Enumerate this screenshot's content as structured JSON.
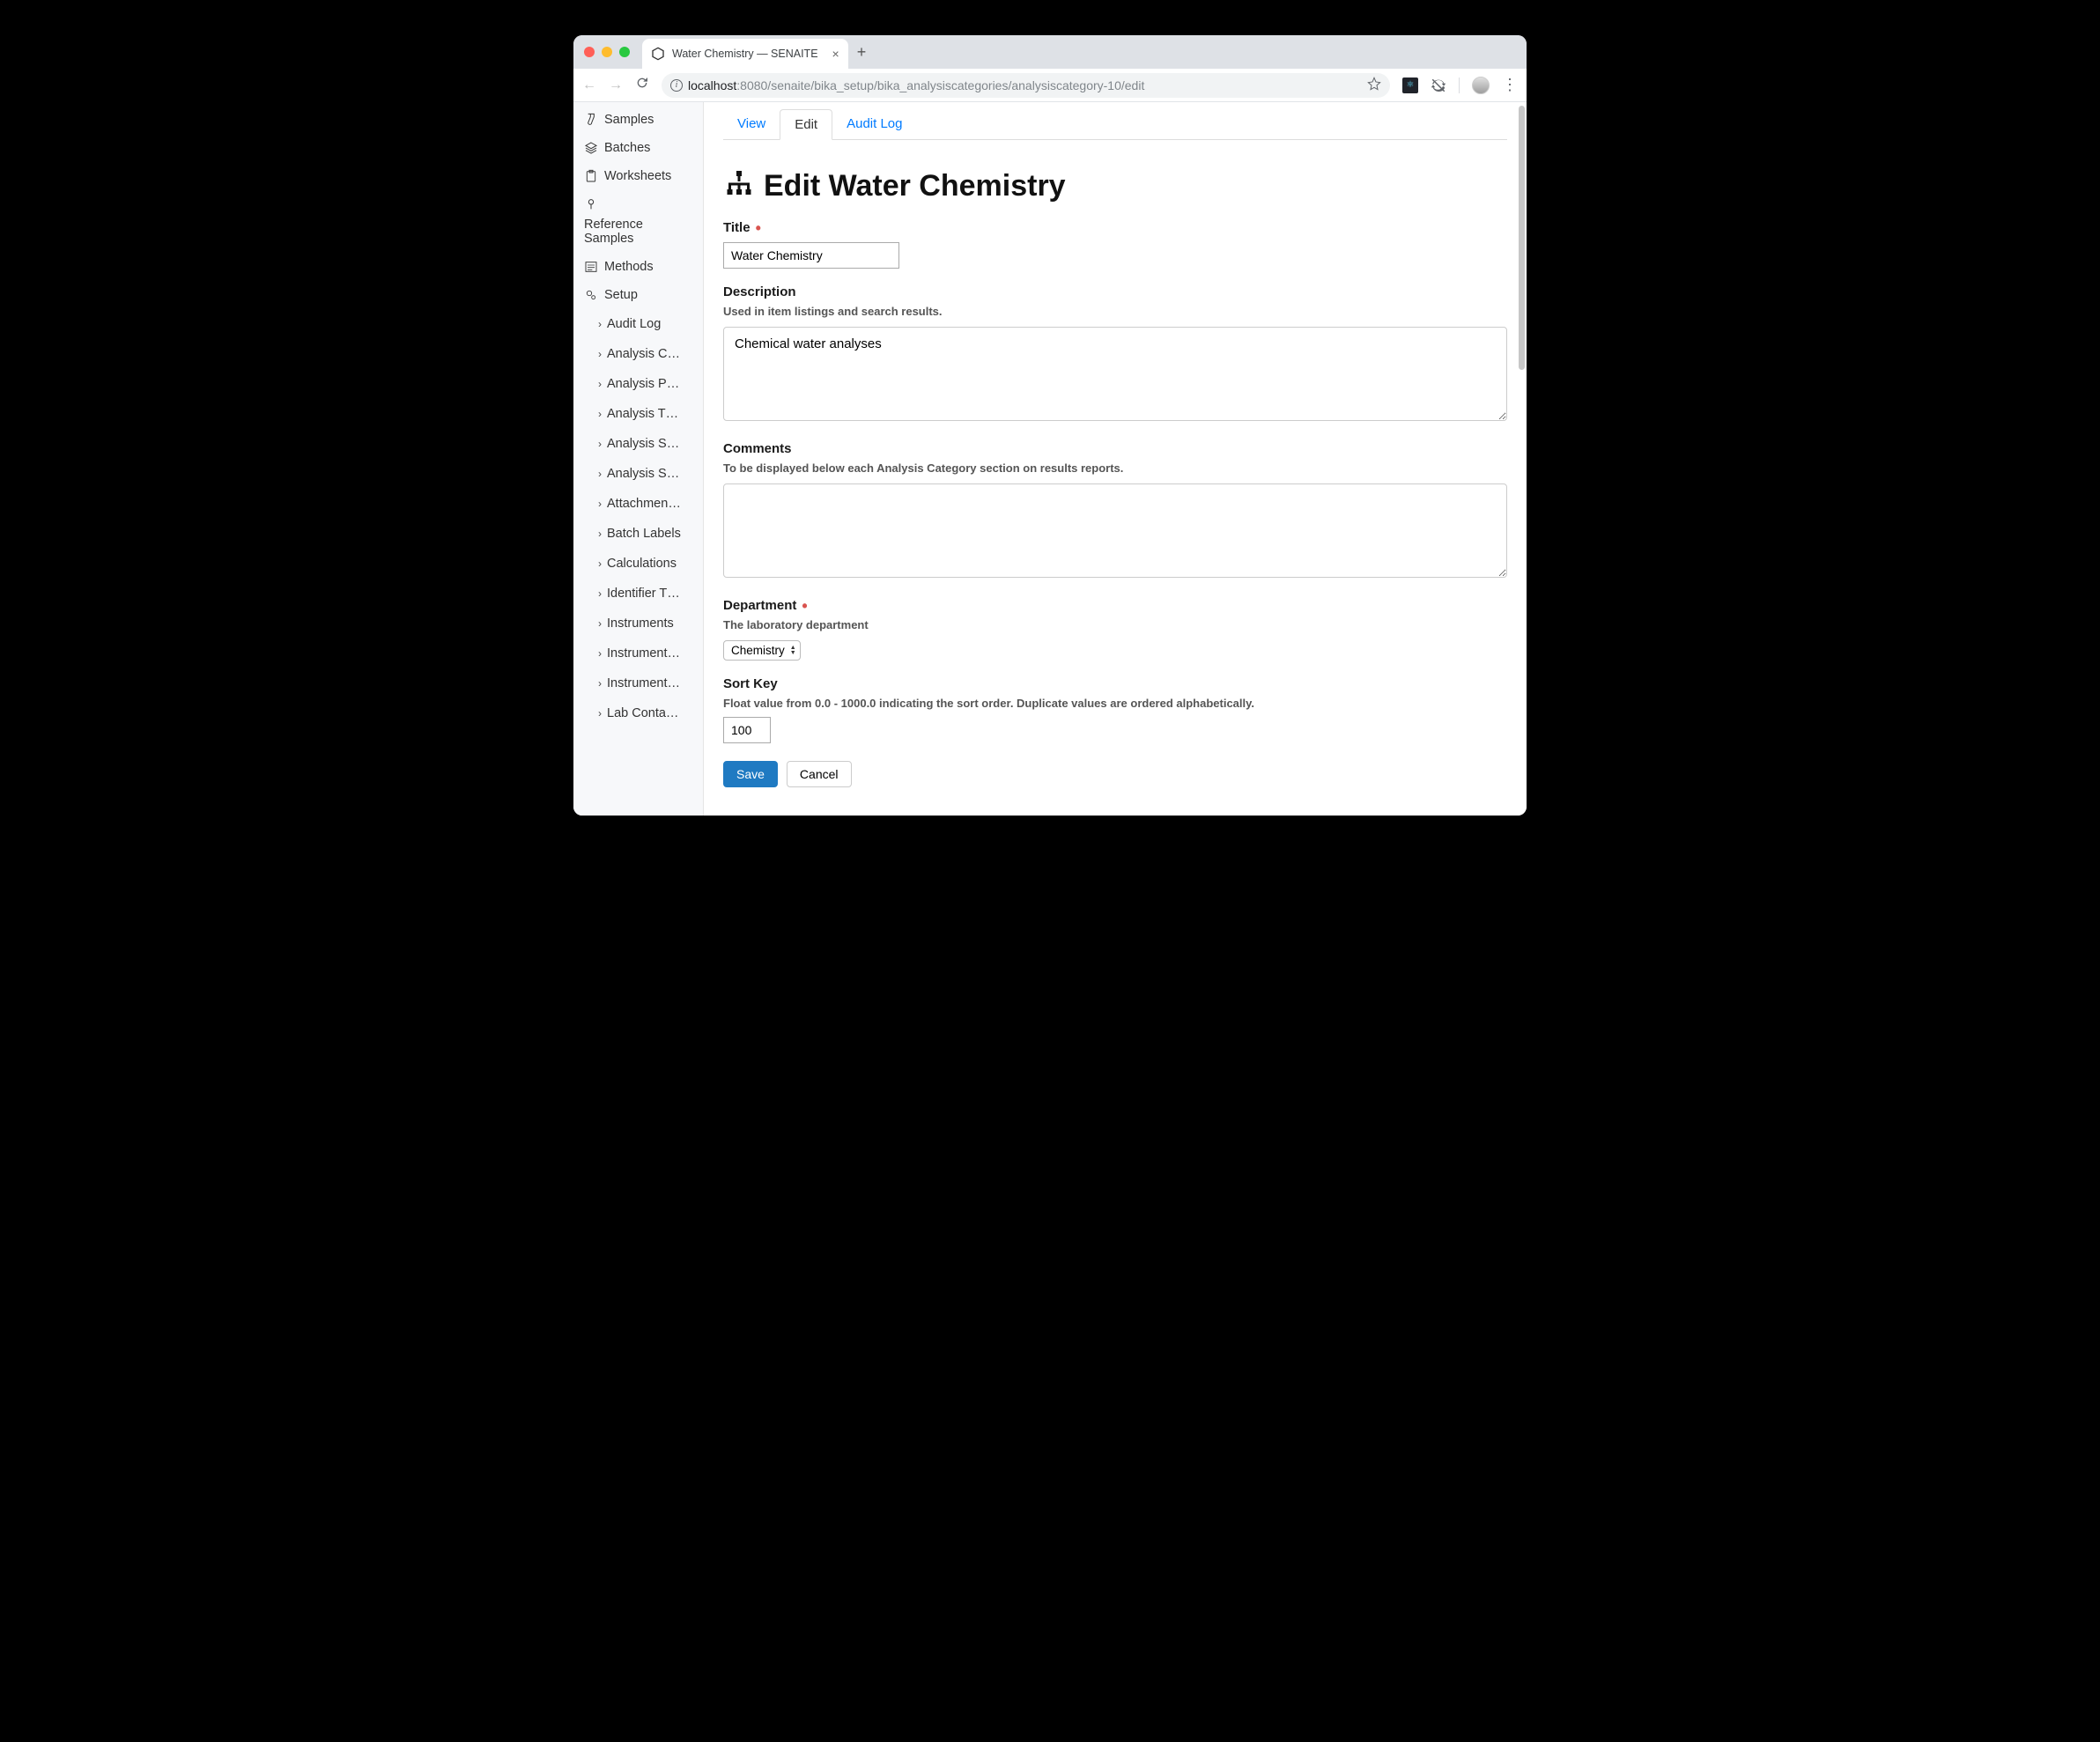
{
  "browser": {
    "tab_title": "Water Chemistry — SENAITE",
    "url_host": "localhost",
    "url_path": ":8080/senaite/bika_setup/bika_analysiscategories/analysiscategory-10/edit"
  },
  "sidebar": {
    "items": [
      {
        "icon": "samples",
        "label": "Samples"
      },
      {
        "icon": "batches",
        "label": "Batches"
      },
      {
        "icon": "worksheets",
        "label": "Worksheets"
      },
      {
        "icon": "reference",
        "label": "Reference Samples"
      },
      {
        "icon": "methods",
        "label": "Methods"
      },
      {
        "icon": "setup",
        "label": "Setup"
      }
    ],
    "setup_children": [
      "Audit Log",
      "Analysis C…",
      "Analysis P…",
      "Analysis T…",
      "Analysis S…",
      "Analysis S…",
      "Attachmen…",
      "Batch Labels",
      "Calculations",
      "Identifier T…",
      "Instruments",
      "Instrument…",
      "Instrument…",
      "Lab Conta…"
    ]
  },
  "tabs": {
    "view": "View",
    "edit": "Edit",
    "audit_log": "Audit Log"
  },
  "page": {
    "heading": "Edit Water Chemistry"
  },
  "form": {
    "title": {
      "label": "Title",
      "value": "Water Chemistry",
      "required": true
    },
    "description": {
      "label": "Description",
      "help": "Used in item listings and search results.",
      "value": "Chemical water analyses"
    },
    "comments": {
      "label": "Comments",
      "help": "To be displayed below each Analysis Category section on results reports.",
      "value": ""
    },
    "department": {
      "label": "Department",
      "help": "The laboratory department",
      "value": "Chemistry",
      "required": true
    },
    "sort_key": {
      "label": "Sort Key",
      "help": "Float value from 0.0 - 1000.0 indicating the sort order. Duplicate values are ordered alphabetically.",
      "value": "100"
    },
    "buttons": {
      "save": "Save",
      "cancel": "Cancel"
    }
  }
}
